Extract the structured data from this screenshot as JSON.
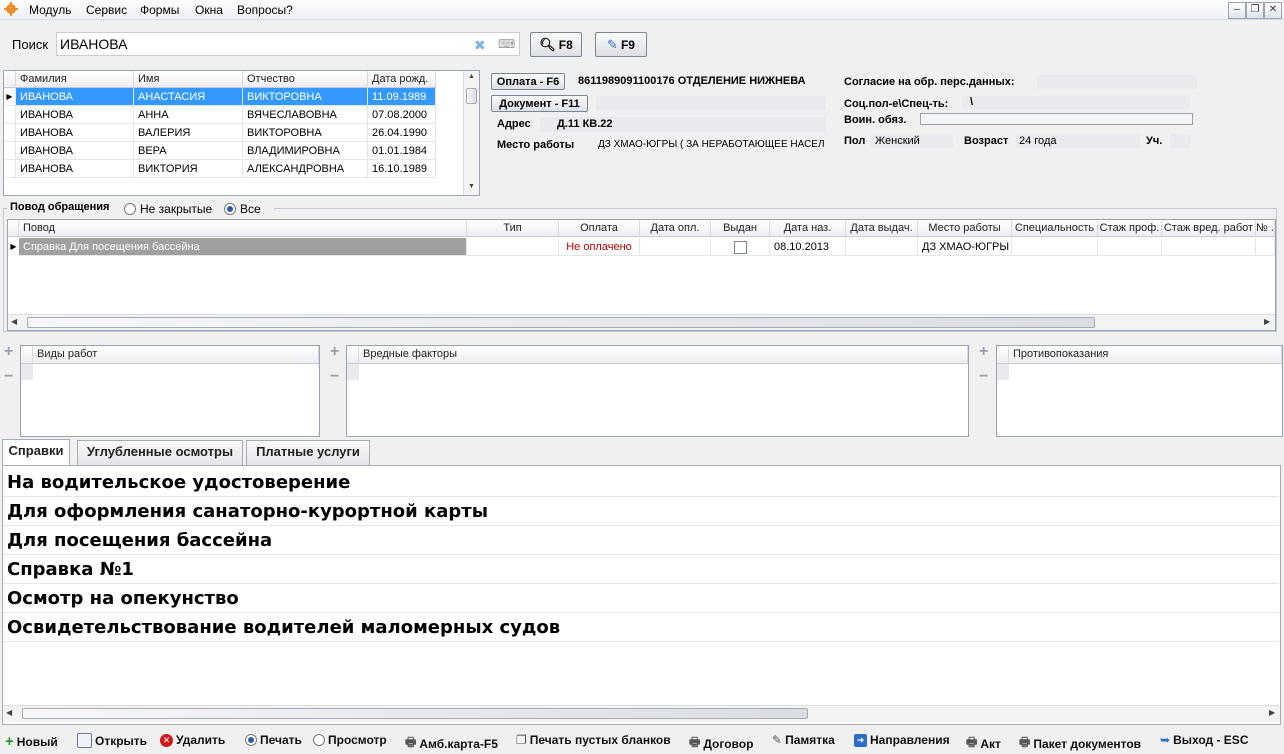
{
  "menu": {
    "items": [
      "Модуль",
      "Сервис",
      "Формы",
      "Окна",
      "Вопросы?"
    ]
  },
  "search": {
    "label": "Поиск",
    "value": "ИВАНОВА",
    "f8_label": "F8",
    "f9_label": "F9"
  },
  "patients": {
    "headers": [
      "Фамилия",
      "Имя",
      "Отчество",
      "Дата рожд."
    ],
    "rows": [
      [
        "ИВАНОВА",
        "АНАСТАСИЯ",
        "ВИКТОРОВНА",
        "11.09.1989"
      ],
      [
        "ИВАНОВА",
        "АННА",
        "ВЯЧЕСЛАВОВНА",
        "07.08.2000"
      ],
      [
        "ИВАНОВА",
        "ВАЛЕРИЯ",
        "ВИКТОРОВНА",
        "26.04.1990"
      ],
      [
        "ИВАНОВА",
        "ВЕРА",
        "ВЛАДИМИРОВНА",
        "01.01.1984"
      ],
      [
        "ИВАНОВА",
        "ВИКТОРИЯ",
        "АЛЕКСАНДРОВНА",
        "16.10.1989"
      ]
    ]
  },
  "info": {
    "payment_btn": "Оплата - F6",
    "payment_value": "8611989091100176 ОТДЕЛЕНИЕ НИЖНЕВА",
    "document_btn": "Документ - F11",
    "address_label": "Адрес",
    "address_value": "Д.11  КВ.22",
    "work_label": "Место работы",
    "work_value": "ДЗ ХМАО-ЮГРЫ ( ЗА НЕРАБОТАЮЩЕЕ НАСЕЛ",
    "consent_label": "Согласие на обр. перс.данных:",
    "social_label": "Соц.пол-е\\Спец-ть:",
    "social_value": "\\",
    "military_label": "Воин. обяз.",
    "sex_label": "Пол",
    "sex_value": "Женский",
    "age_label": "Возраст",
    "age_value": "24 года",
    "uch_label": "Уч."
  },
  "reasons": {
    "title": "Повод обращения",
    "filter_open": "Не закрытые",
    "filter_all": "Все",
    "headers": [
      "Повод",
      "Тип",
      "Оплата",
      "Дата опл.",
      "Выдан",
      "Дата наз.",
      "Дата выдач.",
      "Место работы",
      "Специальность",
      "Стаж проф.",
      "Стаж вред. работ",
      "№ ."
    ],
    "row": {
      "reason": "Справка Для посещения бассейна",
      "payment": "Не оплачено",
      "date_assigned": "08.10.2013",
      "workplace": "ДЗ ХМАО-ЮГРЫ |"
    }
  },
  "panels": {
    "work_types": "Виды работ",
    "harmful": "Вредные факторы",
    "contra": "Противопоказания"
  },
  "tabs": [
    "Справки",
    "Углубленные осмотры",
    "Платные услуги"
  ],
  "certificates": [
    "На водительское удостоверение",
    "Для оформления санаторно-курортной карты",
    "Для посещения бассейна",
    "Справка №1",
    "Осмотр на опекунство",
    "Освидетельствование водителей маломерных судов"
  ],
  "toolbar": {
    "new": "Новый",
    "open": "Открыть",
    "delete": "Удалить",
    "print": "Печать",
    "preview": "Просмотр",
    "amb": "Амб.карта-F5",
    "print_blank": "Печать пустых бланков",
    "contract": "Договор",
    "memo": "Памятка",
    "directions": "Направления",
    "act": "Акт",
    "package": "Пакет документов",
    "exit": "Выход - ESC"
  },
  "colors": {
    "selection": "#3399ff",
    "unpaid": "#c00000",
    "reason_selected": "#a0a0a0"
  }
}
